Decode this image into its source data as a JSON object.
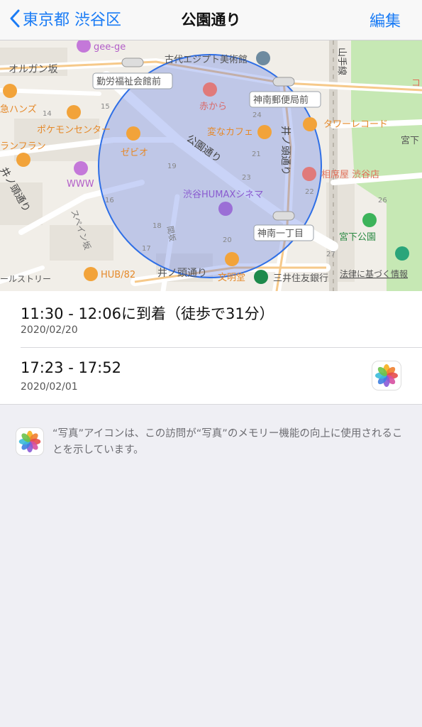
{
  "nav": {
    "back_label": "東京都 渋谷区",
    "title": "公園通り",
    "edit_label": "編集"
  },
  "map": {
    "labels": {
      "gee": "gee-ge",
      "egypt": "古代エジプト美術館",
      "organ": "オルガン坂",
      "kinro": "勤労福祉会館前",
      "akakara": "赤から",
      "jinnan_post": "神南郵便局前",
      "yamanote": "山手線",
      "hands": "急ハンズ",
      "pokemon": "ポケモンセンター",
      "henna": "変なカフェ",
      "inokashira_v": "井ノ頭通り",
      "tower": "タワーレコード",
      "miyashita_top": "宮下",
      "franfran": "ランフラン",
      "zebio": "ゼビオ",
      "koen": "公園通り",
      "sobaya": "相席屋 渋谷店",
      "inokashira_l": "井ノ頭通り",
      "www": "WWW",
      "humax": "渋谷HUMAXシネマ",
      "spain": "スペイン坂",
      "miyashita_park": "宮下公園",
      "jinnan_itchome": "神南一丁目",
      "hmm": "間坂",
      "hub": "HUB/82",
      "bunmeido": "文明堂",
      "smbc": "三井住友銀行",
      "law": "法律に基づく情報",
      "inokashira_b": "井ノ頭通り",
      "rurst": "ールストリー",
      "ko": "コ",
      "n14": "14",
      "n15": "15",
      "n16": "16",
      "n17": "17",
      "n18": "18",
      "n19": "19",
      "n20": "20",
      "n21": "21",
      "n22": "22",
      "n23": "23",
      "n24": "24",
      "n26": "26",
      "n27": "27"
    }
  },
  "visits": [
    {
      "time": "11:30 - 12:06に到着（徒歩で31分）",
      "date": "2020/02/20",
      "has_photos": false
    },
    {
      "time": "17:23 - 17:52",
      "date": "2020/02/01",
      "has_photos": true
    }
  ],
  "footnote": {
    "text": "“写真”アイコンは、この訪問が“写真”のメモリー機能の向上に使用されることを示しています。"
  },
  "colors": {
    "accent": "#1b7cf5",
    "circle": "#3a6fe0",
    "park": "#c6e8b4"
  }
}
